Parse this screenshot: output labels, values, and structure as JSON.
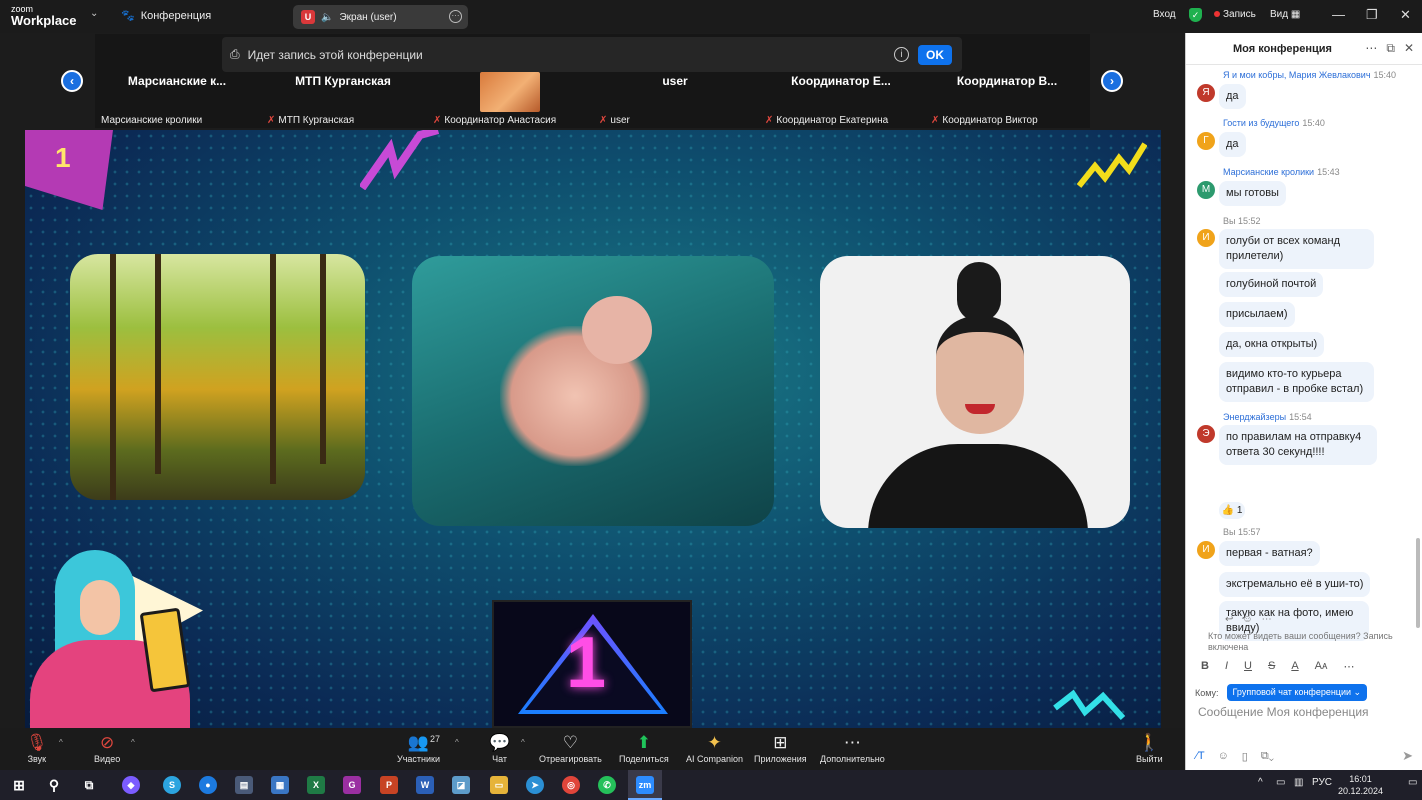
{
  "topbar": {
    "logo_line1": "zoom",
    "logo_line2": "Workplace",
    "conference_label": "Конференция",
    "share_badge": "U",
    "share_label": "Экран (user)",
    "login": "Вход",
    "record": "Запись",
    "view": "Вид"
  },
  "recbar": {
    "text": "Идет запись этой конференции",
    "ok": "OK"
  },
  "participants": [
    {
      "name": "Марсианские  к...",
      "label": "Марсианские кролики",
      "muted": false
    },
    {
      "name": "МТП Курганская",
      "label": "МТП Курганская",
      "muted": true
    },
    {
      "name": "",
      "label": "Координатор Анастасия",
      "muted": true
    },
    {
      "name": "user",
      "label": "user",
      "muted": true
    },
    {
      "name": "Координатор  Е...",
      "label": "Координатор Екатерина",
      "muted": true
    },
    {
      "name": "Координатор  В...",
      "label": "Координатор Виктор",
      "muted": true
    }
  ],
  "slide": {
    "corner_number": "1",
    "big_number": "1"
  },
  "bottombar": {
    "audio": "Звук",
    "video": "Видео",
    "participants": "Участники",
    "participants_count": "27",
    "chat": "Чат",
    "react": "Отреагировать",
    "share": "Поделиться",
    "ai": "AI Companion",
    "apps": "Приложения",
    "more": "Дополнительно",
    "leave": "Выйти"
  },
  "chat": {
    "title": "Моя конференция",
    "messages": [
      {
        "sender": "Я и мои кобры, Мария Жевлакович",
        "time": "15:40",
        "avatar": "Я",
        "color": "#c0392b",
        "texts": [
          "да"
        ]
      },
      {
        "sender": "Гости из будущего",
        "time": "15:40",
        "avatar": "Г",
        "color": "#f0a31a",
        "texts": [
          "да"
        ]
      },
      {
        "sender": "Марсианские кролики",
        "time": "15:43",
        "avatar": "М",
        "color": "#2d9a6e",
        "texts": [
          "мы готовы"
        ]
      },
      {
        "sender": "Вы",
        "time": "15:52",
        "avatar": "И",
        "color": "#f0a31a",
        "texts": [
          "голуби от всех команд прилетели)",
          "голубиной почтой",
          "присылаем)",
          "да, окна открыты)",
          "видимо кто-то курьера отправил - в пробке встал)"
        ]
      },
      {
        "sender": "Энерджайзеры",
        "time": "15:54",
        "avatar": "Э",
        "color": "#c0392b",
        "texts": [
          "по правилам на отправку4 ответа 30 секунд!!!!"
        ]
      },
      {
        "sender": "Вы",
        "time": "15:57",
        "avatar": "И",
        "color": "#f0a31a",
        "texts": [
          "первая - ватная?",
          "экстремально её в уши-то)",
          "такую как на фото, имею ввиду)"
        ]
      }
    ],
    "reaction": "👍 1",
    "privacy": "Кто может видеть ваши сообщения? Запись включена",
    "to_label": "Кому:",
    "to_value": "Групповой чат конференции ⌄",
    "placeholder": "Сообщение Моя конференция"
  },
  "taskbar": {
    "lang": "РУС",
    "time": "16:01",
    "date": "20.12.2024"
  }
}
